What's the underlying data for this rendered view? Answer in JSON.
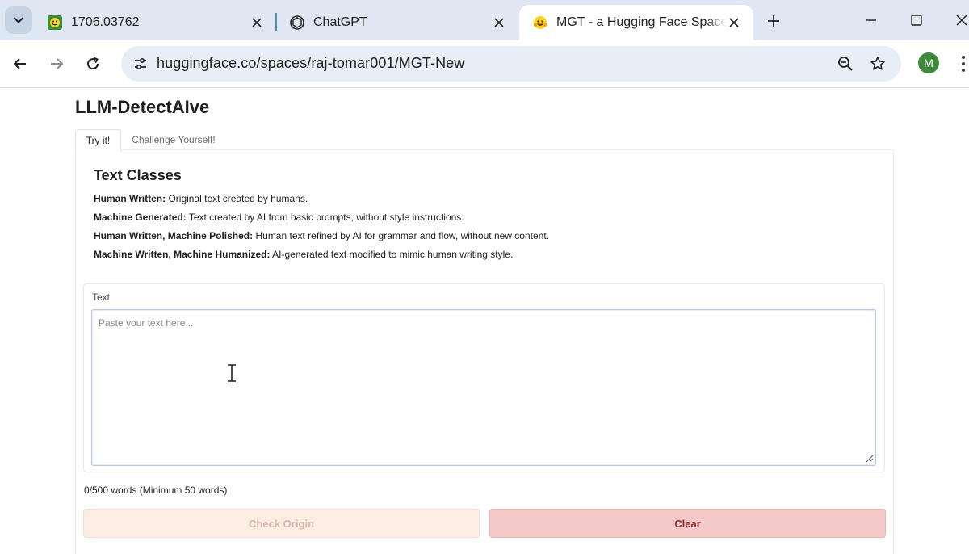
{
  "browser": {
    "tabs": [
      {
        "title": "1706.03762",
        "favicon": "arxiv-favicon-icon"
      },
      {
        "title": "ChatGPT",
        "favicon": "chatgpt-favicon-icon"
      },
      {
        "title": "MGT - a Hugging Face Space by",
        "favicon": "huggingface-favicon-icon",
        "active": true
      }
    ],
    "url": "huggingface.co/spaces/raj-tomar001/MGT-New",
    "profile_initial": "M",
    "accent_color": "#dfe7f2"
  },
  "page": {
    "app_title": "LLM-DetectAIve",
    "tabs": [
      "Try it!",
      "Challenge Yourself!"
    ],
    "section_title": "Text Classes",
    "classes": [
      {
        "name": "Human Written:",
        "desc": " Original text created by humans."
      },
      {
        "name": "Machine Generated:",
        "desc": " Text created by AI from basic prompts, without style instructions."
      },
      {
        "name": "Human Written, Machine Polished:",
        "desc": " Human text refined by AI for grammar and flow, without new content."
      },
      {
        "name": "Machine Written, Machine Humanized:",
        "desc": " AI-generated text modified to mimic human writing style."
      }
    ],
    "text_label": "Text",
    "text_placeholder": "Paste your text here...",
    "text_value": "",
    "word_count": "0/500 words (Minimum 50 words)",
    "check_button": "Check Origin",
    "clear_button": "Clear"
  }
}
